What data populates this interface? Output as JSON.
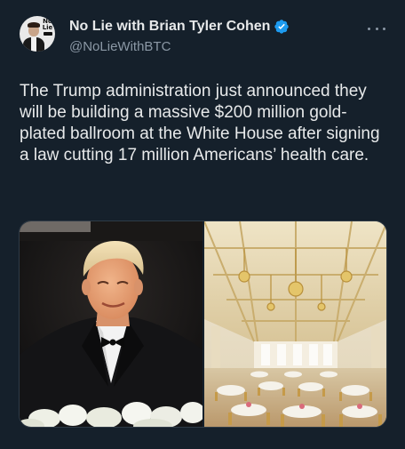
{
  "author": {
    "display_name": "No Lie with Brian Tyler Cohen",
    "handle": "@NoLieWithBTC",
    "avatar_brand": "No Lie",
    "verified": true
  },
  "tweet": {
    "text": "The Trump administration just announced they will be building a massive $200 million gold-plated ballroom at the White House after signing a law cutting 17 million Americans’ health care."
  },
  "colors": {
    "background": "#15202b",
    "text": "#e7e9ea",
    "secondary": "#8b98a5",
    "verified": "#1d9bf0"
  },
  "icons": {
    "verified": "verified-badge-icon",
    "more": "more-options-icon"
  }
}
